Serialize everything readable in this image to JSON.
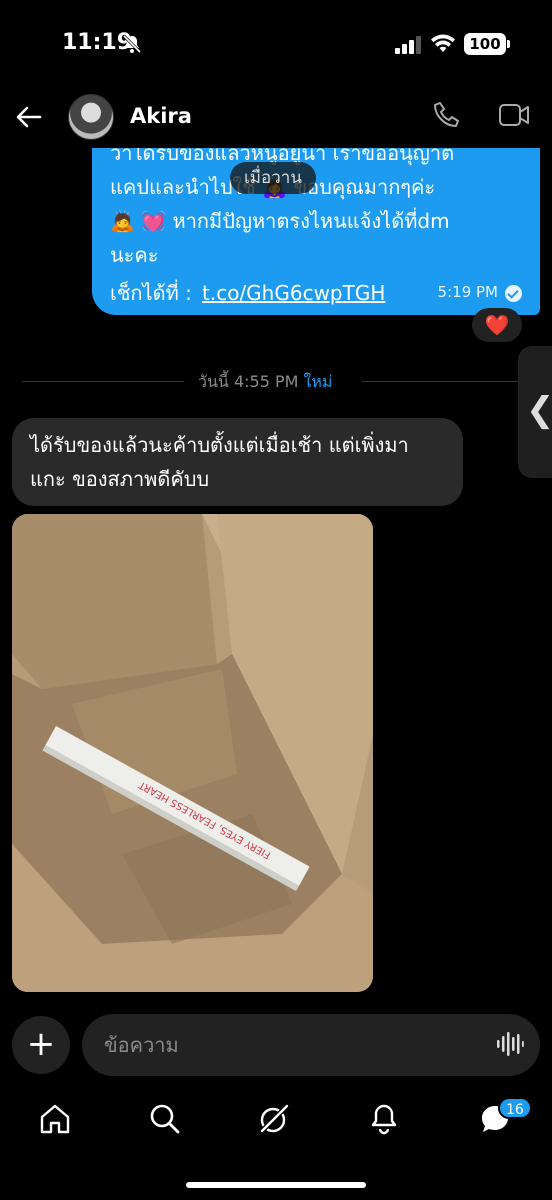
{
  "status": {
    "time": "11:19",
    "battery": "100"
  },
  "header": {
    "contact_name": "Akira"
  },
  "messages": {
    "sent_text": "ว่าได้รับของแล้วหนูอยู่นา เราขออนุญาต\nแคปและนำไปใช้ 🙇‍♀️  ขอบคุณมากๆค่ะ\n🙇 💓 หากมีปัญหาตรงไหนแจ้งได้ที่dm\nนะคะ",
    "sent_link_prefix": "เช็กได้ที่ : ",
    "sent_link": "t.co/GhG6cwpTGH",
    "sent_time": "5:19 PM",
    "date_pill": "เมื่อวาน",
    "reaction": "❤️",
    "divider_text": "วันนี้ 4:55 PM",
    "divider_new": "ใหม่",
    "received_text": "ได้รับของแล้วนะค้าบตั้งแต่เมื่อเช้า แต่เพิ่งมา\nแกะ ของสภาพดีคับบ",
    "photo_product_text": "FIERY EYES, FEARLESS HEART"
  },
  "composer": {
    "placeholder": "ข้อความ"
  },
  "nav": {
    "messages_badge": "16"
  }
}
